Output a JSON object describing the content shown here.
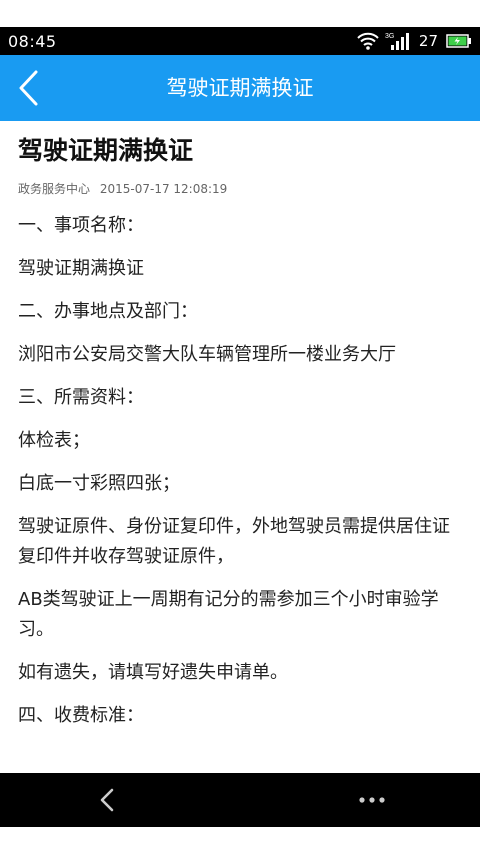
{
  "status_bar": {
    "time": "08:45",
    "network_label": "3G",
    "battery_level": "27"
  },
  "nav": {
    "title": "驾驶证期满换证"
  },
  "article": {
    "title": "驾驶证期满换证",
    "source": "政务服务中心",
    "datetime": "2015-07-17 12:08:19",
    "paragraphs": [
      "一、事项名称：",
      "驾驶证期满换证",
      "二、办事地点及部门：",
      "浏阳市公安局交警大队车辆管理所一楼业务大厅",
      "三、所需资料：",
      "体检表；",
      "白底一寸彩照四张；",
      "驾驶证原件、身份证复印件，外地驾驶员需提供居住证复印件并收存驾驶证原件，",
      "AB类驾驶证上一周期有记分的需参加三个小时审验学习。",
      "如有遗失，请填写好遗失申请单。",
      "四、收费标准："
    ]
  },
  "colors": {
    "nav_background": "#199bf2",
    "status_background": "#000000",
    "bottom_background": "#000000",
    "battery_fill": "#3ecf4a"
  },
  "icons": {
    "nav_back": "chevron-left-icon",
    "bottom_back": "chevron-left-icon",
    "bottom_more": "more-horizontal-icon",
    "wifi": "wifi-icon",
    "signal": "signal-icon",
    "battery": "battery-charging-icon"
  }
}
